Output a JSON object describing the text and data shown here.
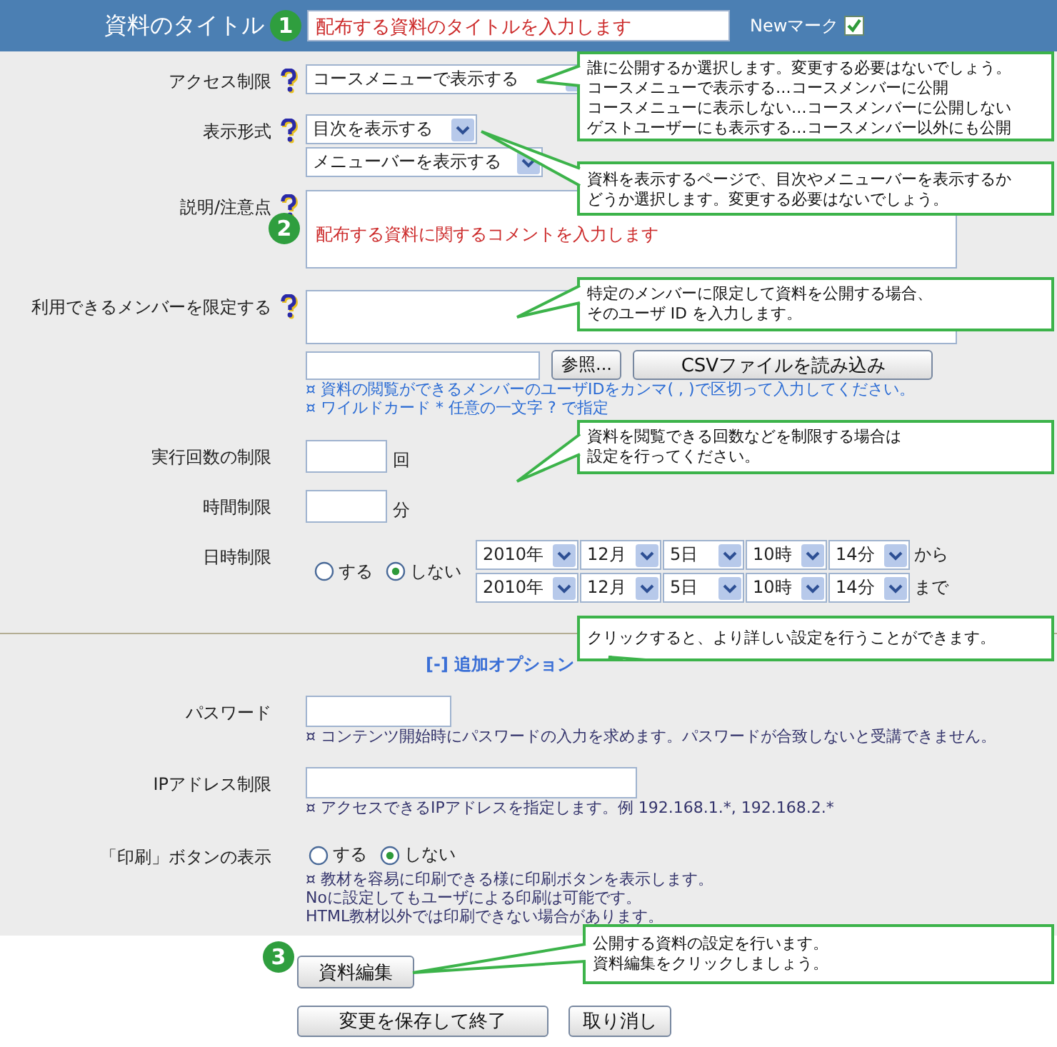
{
  "header": {
    "label": "資料のタイトル",
    "badge": "1",
    "title_value": "配布する資料のタイトルを入力します",
    "new_mark": {
      "label": "Newマーク",
      "checked": true
    }
  },
  "form": {
    "access": {
      "label": "アクセス制限",
      "help": true,
      "value": "コースメニューで表示する"
    },
    "display": {
      "label": "表示形式",
      "help": true,
      "selects": [
        "目次を表示する",
        "メニューバーを表示する"
      ]
    },
    "description": {
      "label": "説明/注意点",
      "help": true,
      "badge": "2",
      "value": "配布する資料に関するコメントを入力します"
    },
    "members": {
      "label": "利用できるメンバーを限定する",
      "help": true,
      "browse_button": "参照...",
      "csv_button": "CSVファイルを読み込み",
      "notes": [
        "¤ 資料の閲覧ができるメンバーのユーザIDをカンマ( , )で区切って入力してください。",
        "¤ ワイルドカード *  任意の一文字 ? で指定"
      ]
    },
    "run_limit": {
      "label": "実行回数の制限",
      "unit": "回"
    },
    "time_limit": {
      "label": "時間制限",
      "unit": "分"
    },
    "date_limit": {
      "label": "日時制限",
      "options": [
        {
          "label": "する",
          "selected": false
        },
        {
          "label": "しない",
          "selected": true
        }
      ],
      "ranges": [
        {
          "parts": [
            "2010年",
            "12月",
            "5日",
            "10時",
            "14分"
          ],
          "suffix": "から"
        },
        {
          "parts": [
            "2010年",
            "12月",
            "5日",
            "10時",
            "14分"
          ],
          "suffix": "まで"
        }
      ]
    }
  },
  "advanced_toggle": "[-] 追加オプション",
  "advanced": {
    "password": {
      "label": "パスワード",
      "note": "¤ コンテンツ開始時にパスワードの入力を求めます。パスワードが合致しないと受講できません。"
    },
    "ip": {
      "label": "IPアドレス制限",
      "note": "¤ アクセスできるIPアドレスを指定します。例 192.168.1.*, 192.168.2.*"
    },
    "print": {
      "label": "「印刷」ボタンの表示",
      "options": [
        {
          "label": "する",
          "selected": false
        },
        {
          "label": "しない",
          "selected": true
        }
      ],
      "notes": [
        "¤ 教材を容易に印刷できる様に印刷ボタンを表示します。",
        "Noに設定してもユーザによる印刷は可能です。",
        "HTML教材以外では印刷できない場合があります。"
      ]
    }
  },
  "actions": {
    "badge": "3",
    "edit_button": "資料編集",
    "save_button": "変更を保存して終了",
    "cancel_button": "取り消し"
  },
  "callouts": [
    {
      "lines": [
        "誰に公開するか選択します。変更する必要はないでしょう。",
        "コースメニューで表示する…コースメンバーに公開",
        "コースメニューに表示しない…コースメンバーに公開しない",
        "ゲストユーザーにも表示する…コースメンバー以外にも公開"
      ]
    },
    {
      "lines": [
        "資料を表示するページで、目次やメニューバーを表示するか",
        "どうか選択します。変更する必要はないでしょう。"
      ]
    },
    {
      "lines": [
        "特定のメンバーに限定して資料を公開する場合、",
        "そのユーザ ID を入力します。"
      ]
    },
    {
      "lines": [
        "資料を閲覧できる回数などを制限する場合は",
        "設定を行ってください。"
      ]
    },
    {
      "lines": [
        "クリックすると、より詳しい設定を行うことができます。"
      ]
    },
    {
      "lines": [
        "公開する資料の設定を行います。",
        "資料編集をクリックしましょう。"
      ]
    }
  ]
}
